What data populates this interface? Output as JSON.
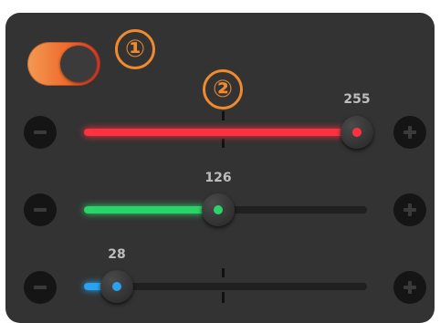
{
  "toggle": {
    "state": "on",
    "accent": "#ef6a2e"
  },
  "callouts": [
    "①",
    "②"
  ],
  "sliders": [
    {
      "name": "red",
      "value": "255",
      "fraction": 1.0,
      "color": "#ff3140"
    },
    {
      "name": "green",
      "value": "126",
      "fraction": 0.49,
      "color": "#2bd36b"
    },
    {
      "name": "blue",
      "value": "28",
      "fraction": 0.12,
      "color": "#29a3ef"
    }
  ],
  "buttons": {
    "decrement_icon": "minus-icon",
    "increment_icon": "plus-icon"
  }
}
